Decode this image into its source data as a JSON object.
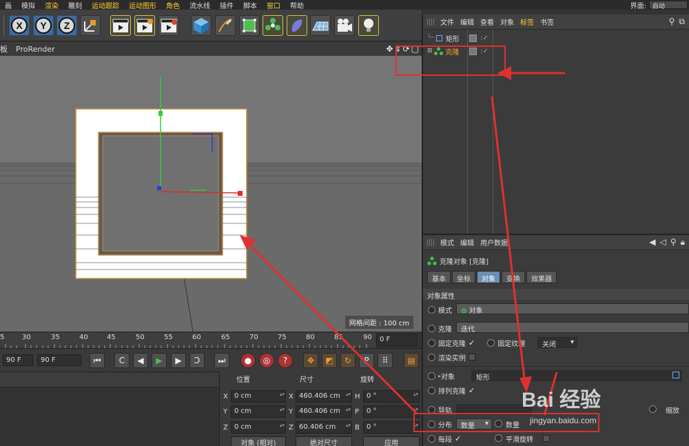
{
  "menubar": {
    "items": [
      "画",
      "模拟",
      "渲染",
      "雕刻",
      "运动跟踪",
      "运动图形",
      "角色",
      "流水线",
      "插件",
      "脚本",
      "窗口",
      "帮助"
    ],
    "layout_label": "界面:",
    "layout_value": "启动"
  },
  "toolbar": {
    "axis_x": "X",
    "axis_y": "Y",
    "axis_z": "Z"
  },
  "viewport": {
    "header_left": "板",
    "renderer": "ProRender",
    "grid_spacing": "网格间距 : 100 cm"
  },
  "timeline": {
    "ticks": [
      "5",
      "30",
      "35",
      "40",
      "45",
      "50",
      "55",
      "60",
      "65",
      "70",
      "75",
      "80",
      "85",
      "90"
    ],
    "current_frame": "0 F",
    "start_frame": "90 F",
    "end_frame": "90 F"
  },
  "coords": {
    "headers": {
      "position": "位置",
      "size": "尺寸",
      "rotation": "旋转"
    },
    "rows": [
      {
        "axis": "X",
        "pos": "0 cm",
        "size_axis": "X",
        "size": "460.406 cm",
        "rot_axis": "H",
        "rot": "0 °"
      },
      {
        "axis": "Y",
        "pos": "0 cm",
        "size_axis": "Y",
        "size": "460.406 cm",
        "rot_axis": "P",
        "rot": "0 °"
      },
      {
        "axis": "Z",
        "pos": "0 cm",
        "size_axis": "Z",
        "size": "60.406 cm",
        "rot_axis": "B",
        "rot": "0 °"
      }
    ],
    "mode_dropdown": "对象 (相对)",
    "size_dropdown": "绝对尺寸",
    "apply_button": "应用"
  },
  "object_manager": {
    "menu": [
      "文件",
      "编辑",
      "查看",
      "对象",
      "标签",
      "书签"
    ],
    "active_menu": "标签",
    "objects": [
      {
        "name": "矩形",
        "selected": false
      },
      {
        "name": "克隆",
        "selected": true
      }
    ]
  },
  "attributes": {
    "menu": [
      "模式",
      "编辑",
      "用户数据"
    ],
    "title": "克隆对象 [克隆]",
    "tabs": [
      "基本",
      "坐标",
      "对象",
      "变换",
      "效果器"
    ],
    "active_tab": "对象",
    "section": "对象属性",
    "mode_label": "模式",
    "mode_value": "对象",
    "clone_label": "克隆",
    "clone_value": "迭代",
    "fix_clone_label": "固定克隆",
    "fix_texture_label": "固定纹理",
    "fix_texture_value": "关闭",
    "render_instance_label": "渲染实例",
    "object_label": "对象",
    "object_value": "矩形",
    "arrange_label": "排列克隆",
    "rail_label": "导轨",
    "scale_label": "缩放",
    "distribution_label": "分布",
    "distribution_value": "数量",
    "count_label": "数量",
    "each_segment_label": "每段",
    "smooth_rotation_label": "平滑旋转"
  },
  "watermark": {
    "logo": "Bai 经验",
    "url": "jingyan.baidu.com"
  },
  "colors": {
    "accent_blue": "#3f6a9b",
    "selection_orange": "#f0a030",
    "annotation_red": "#e03030"
  }
}
